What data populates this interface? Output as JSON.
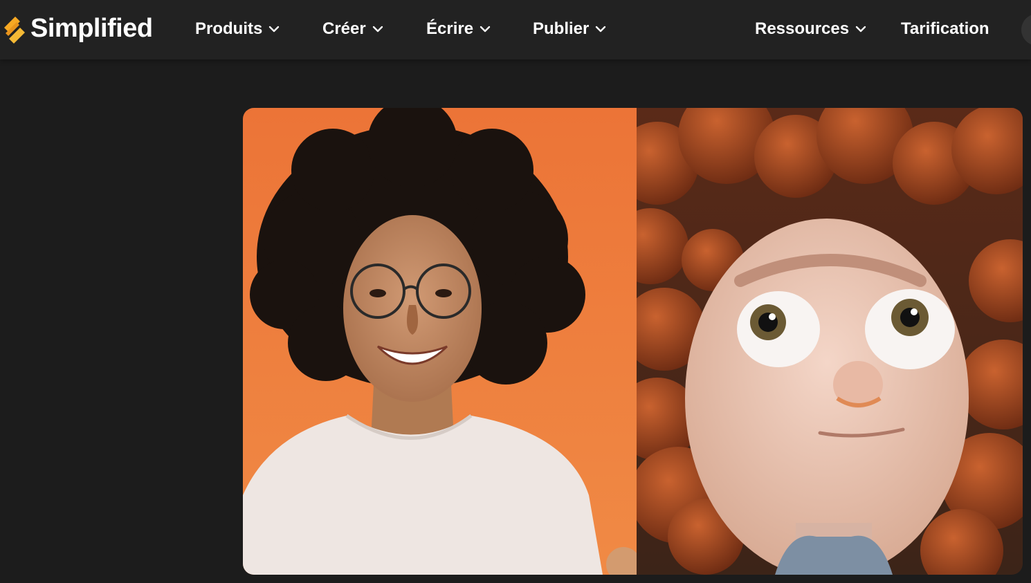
{
  "brand": {
    "name": "Simplified",
    "accent": "#f7a823"
  },
  "nav": {
    "items": [
      {
        "label": "Produits",
        "has_dropdown": true
      },
      {
        "label": "Créer",
        "has_dropdown": true
      },
      {
        "label": "Écrire",
        "has_dropdown": true
      },
      {
        "label": "Publier",
        "has_dropdown": true
      },
      {
        "label": "Ressources",
        "has_dropdown": true
      },
      {
        "label": "Tarification",
        "has_dropdown": false
      }
    ]
  },
  "hero": {
    "left_background": "#ec7a3c",
    "right_background": "#7a3618"
  },
  "colors": {
    "page_bg": "#1c1c1c",
    "nav_bg": "#222222",
    "nav_text": "#ffffff"
  }
}
